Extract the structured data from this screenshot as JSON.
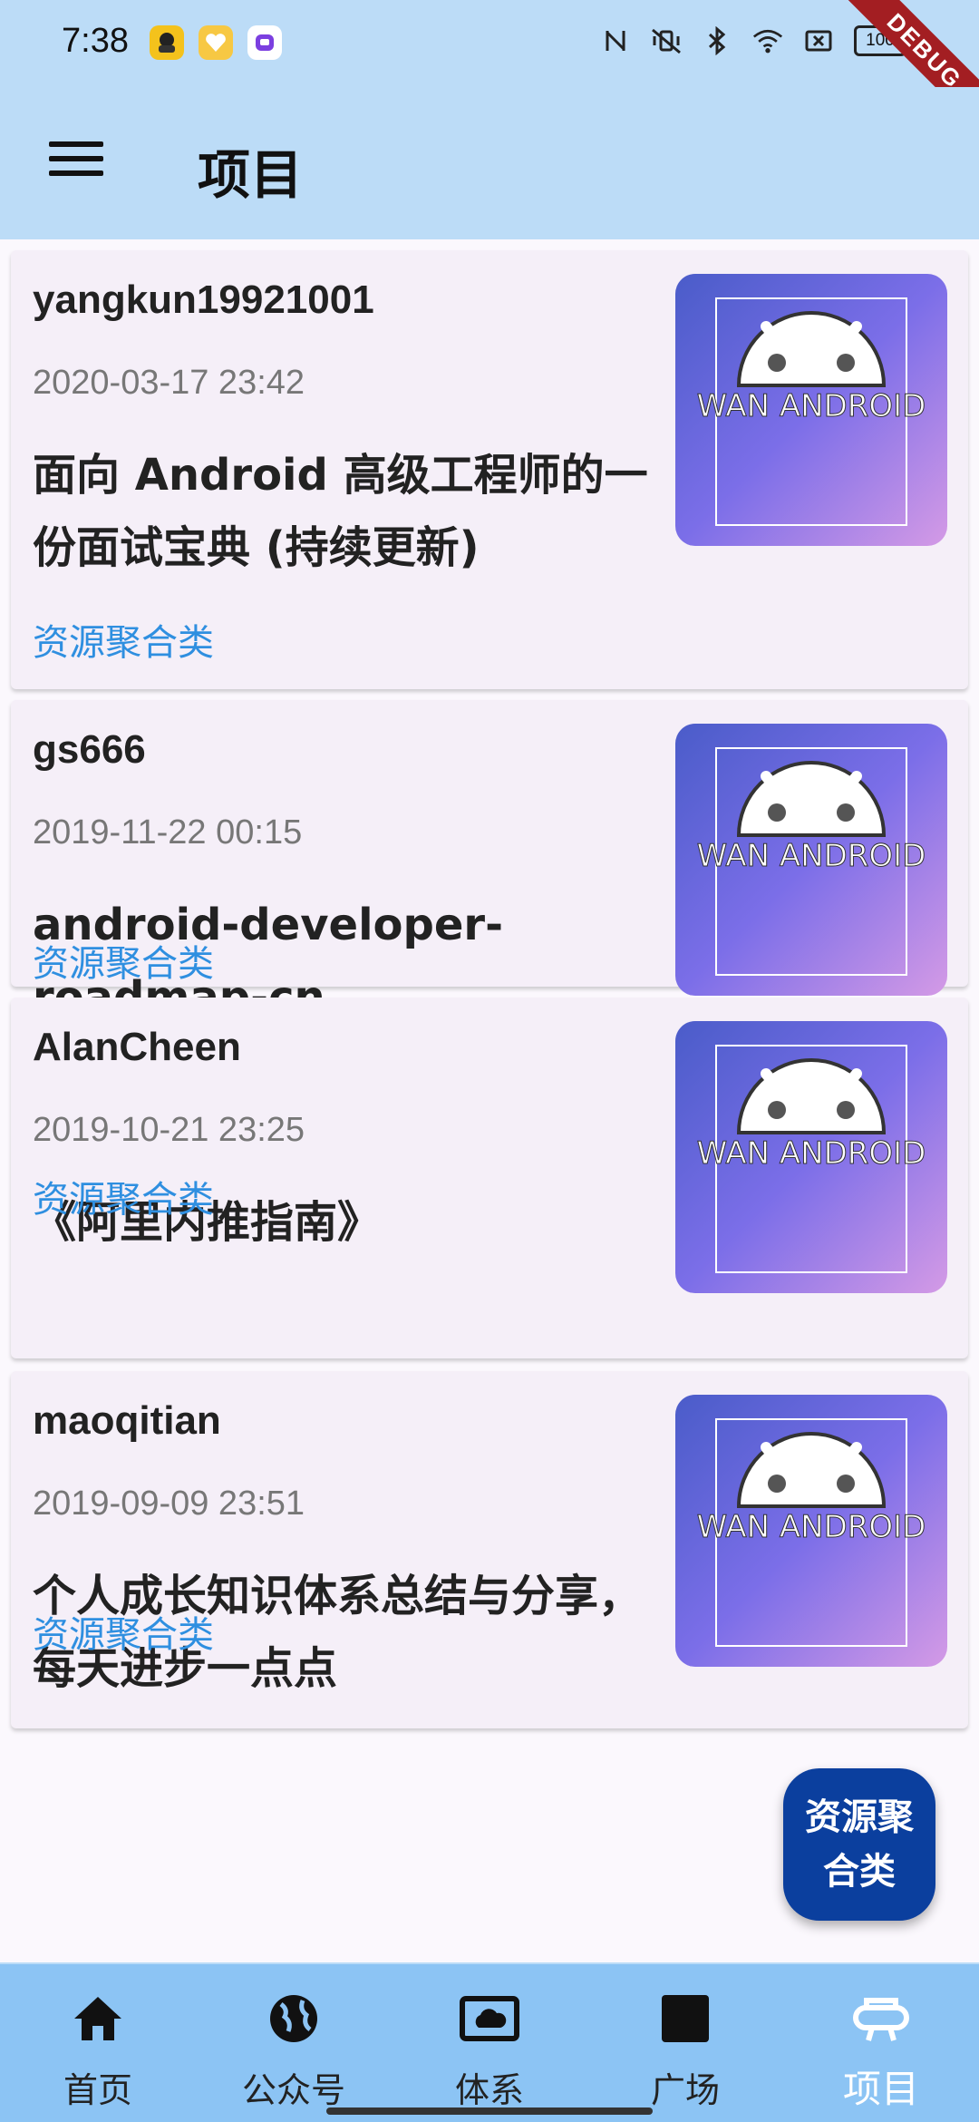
{
  "status_bar": {
    "time": "7:38",
    "battery": "100",
    "notification_icons": [
      "app-avatar-icon",
      "app-heart-icon",
      "app-chat-icon"
    ],
    "system_icons": [
      "nfc-icon",
      "vibrate-icon",
      "bluetooth-icon",
      "wifi-icon",
      "screen-cast-icon"
    ]
  },
  "debug_banner": "DEBUG",
  "app_bar": {
    "title": "项目",
    "menu_icon": "menu-icon"
  },
  "articles": [
    {
      "author": "yangkun19921001",
      "date": "2020-03-17 23:42",
      "title": "面向 Android 高级工程师的一份面试宝典 (持续更新)",
      "tag": "资源聚合类",
      "thumb_text": "WAN ANDROID"
    },
    {
      "author": "gs666",
      "date": "2019-11-22 00:15",
      "title": "android-developer-roadmap-cn",
      "tag": "资源聚合类",
      "thumb_text": "WAN ANDROID"
    },
    {
      "author": "AlanCheen",
      "date": "2019-10-21 23:25",
      "title": "《阿里内推指南》",
      "tag": "资源聚合类",
      "thumb_text": "WAN ANDROID"
    },
    {
      "author": "maoqitian",
      "date": "2019-09-09 23:51",
      "title": "个人成长知识体系总结与分享，每天进步一点点",
      "tag": "资源聚合类",
      "thumb_text": "WAN ANDROID"
    }
  ],
  "fab": {
    "label": "资源聚合类"
  },
  "bottom_nav": [
    {
      "label": "首页",
      "icon": "home-icon",
      "active": false
    },
    {
      "label": "公众号",
      "icon": "globe-icon",
      "active": false
    },
    {
      "label": "体系",
      "icon": "cloud-tv-icon",
      "active": false
    },
    {
      "label": "广场",
      "icon": "square-icon",
      "active": false
    },
    {
      "label": "项目",
      "icon": "project-icon",
      "active": true
    }
  ],
  "colors": {
    "app_bar_bg": "#bcdcf7",
    "card_bg": "#f5eff8",
    "tag_blue": "#2f8fe0",
    "fab_bg": "#0b3f9e",
    "bottom_nav_bg": "#8cc4f4"
  }
}
